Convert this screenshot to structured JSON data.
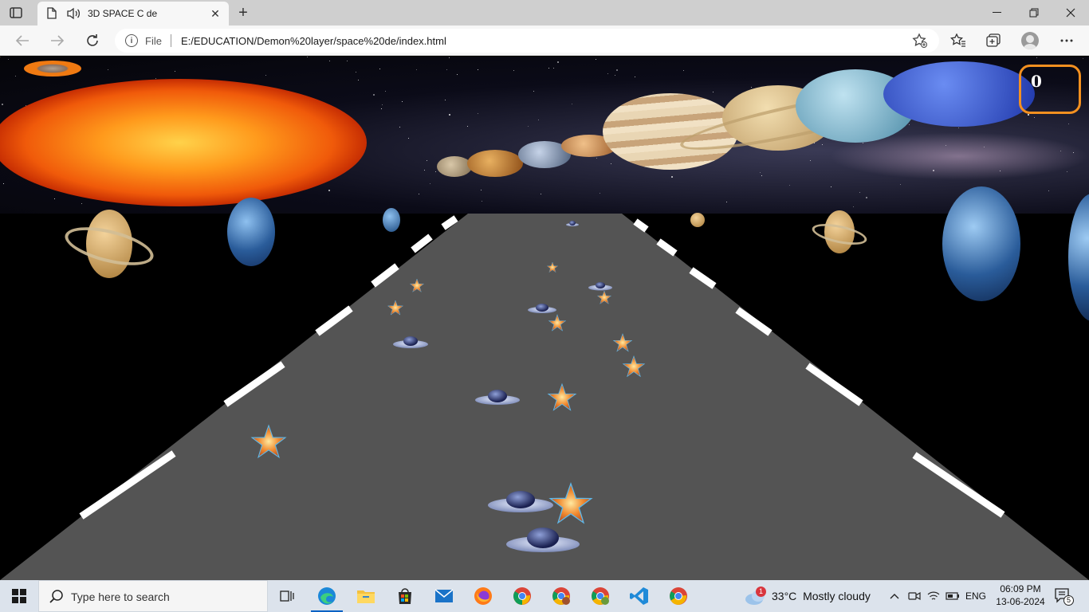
{
  "browser": {
    "tab_title": "3D SPACE C de",
    "url_scheme_label": "File",
    "url": "E:/EDUCATION/Demon%20layer/space%20de/index.html"
  },
  "game": {
    "score": "0"
  },
  "taskbar": {
    "search_placeholder": "Type here to search",
    "weather_temp": "33°C",
    "weather_text": "Mostly cloudy",
    "weather_badge": "1",
    "language": "ENG",
    "time": "06:09 PM",
    "date": "13-06-2024",
    "notification_count": "5"
  },
  "colors": {
    "road": "#545454",
    "road_edge_stripe": "#ffffff",
    "score_border": "#f39020",
    "taskbar_bg": "#dce3ec"
  }
}
